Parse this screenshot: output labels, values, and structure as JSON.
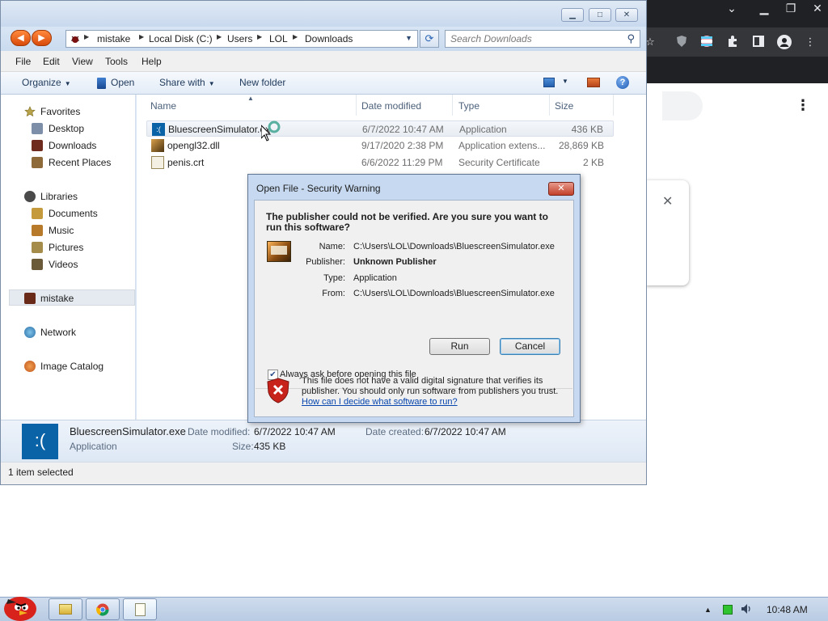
{
  "chrome": {
    "minimize_glyph": "⌄",
    "kebab_glyph": "⋮",
    "close_card_glyph": "✕"
  },
  "explorer": {
    "window_buttons": {
      "minimize": "▁",
      "maximize": "□",
      "close": "✕"
    },
    "address": {
      "crumbs": [
        "mistake",
        "Local Disk (C:)",
        "Users",
        "LOL",
        "Downloads"
      ],
      "separator": "▶"
    },
    "search": {
      "placeholder": "Search Downloads"
    },
    "menu": [
      "File",
      "Edit",
      "View",
      "Tools",
      "Help"
    ],
    "commands": {
      "organize": "Organize",
      "open": "Open",
      "share_with": "Share with",
      "new_folder": "New folder"
    },
    "nav": {
      "favorites": "Favorites",
      "desktop": "Desktop",
      "downloads": "Downloads",
      "recent_places": "Recent Places",
      "libraries": "Libraries",
      "documents": "Documents",
      "music": "Music",
      "pictures": "Pictures",
      "videos": "Videos",
      "computer": "mistake",
      "network": "Network",
      "image_catalog": "Image Catalog"
    },
    "columns": {
      "name": "Name",
      "date_modified": "Date modified",
      "type": "Type",
      "size": "Size"
    },
    "files": [
      {
        "name": "BluescreenSimulator.exe",
        "date": "6/7/2022 10:47 AM",
        "type": "Application",
        "size": "436 KB",
        "icon": "bluescreen-icon"
      },
      {
        "name": "opengl32.dll",
        "date": "9/17/2020 2:38 PM",
        "type": "Application extens...",
        "size": "28,869 KB",
        "icon": "dll-icon"
      },
      {
        "name": "penis.crt",
        "date": "6/6/2022 11:29 PM",
        "type": "Security Certificate",
        "size": "2 KB",
        "icon": "certificate-icon"
      }
    ],
    "details": {
      "icon_glyph": ":(",
      "filename": "BluescreenSimulator.exe",
      "type": "Application",
      "date_modified_label": "Date modified:",
      "date_modified": "6/7/2022 10:47 AM",
      "date_created_label": "Date created:",
      "date_created": "6/7/2022 10:47 AM",
      "size_label": "Size:",
      "size": "435 KB"
    },
    "status": "1 item selected"
  },
  "dialog": {
    "title": "Open File - Security Warning",
    "close_glyph": "✕",
    "headline": "The publisher could not be verified.  Are you sure you want to run this software?",
    "fields": [
      {
        "label": "Name:",
        "value": "C:\\Users\\LOL\\Downloads\\BluescreenSimulator.exe",
        "bold": false
      },
      {
        "label": "Publisher:",
        "value": "Unknown Publisher",
        "bold": true
      },
      {
        "label": "Type:",
        "value": "Application",
        "bold": false
      },
      {
        "label": "From:",
        "value": "C:\\Users\\LOL\\Downloads\\BluescreenSimulator.exe",
        "bold": false
      }
    ],
    "run_label": "Run",
    "cancel_label": "Cancel",
    "checkbox_label": "Always ask before opening this file",
    "checkbox_checked": true,
    "warning_text": "This file does not have a valid digital signature that verifies its publisher.  You should only run software from publishers you trust.",
    "help_link": "How can I decide what software to run?"
  },
  "taskbar": {
    "clock": "10:48 AM",
    "tray_arrow": "▲",
    "volume_glyph": "🔊"
  },
  "colors": {
    "dialog_frame": "#c6d9f0",
    "link": "#0645ad",
    "selection": "#e5eaf0",
    "taskbar": "#c4d5ea"
  }
}
